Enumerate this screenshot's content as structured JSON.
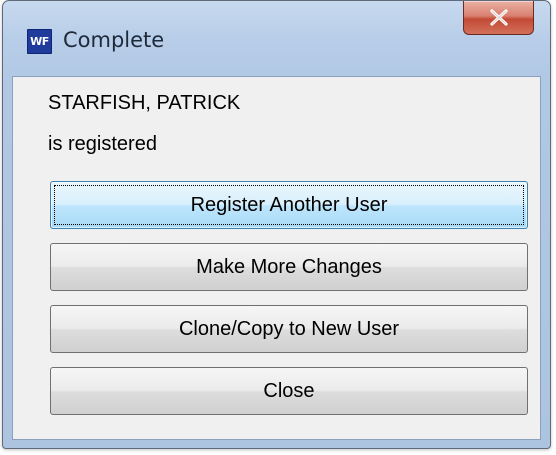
{
  "window": {
    "icon_text": "WF",
    "title": "Complete"
  },
  "message": {
    "name": "STARFISH, PATRICK",
    "status": "is registered"
  },
  "buttons": {
    "register_another": "Register Another User",
    "make_changes": "Make More Changes",
    "clone_copy": "Clone/Copy to New User",
    "close": "Close"
  },
  "colors": {
    "frame": "#b7cde8",
    "client_background": "#f0f0f0",
    "close_button": "#c24a35",
    "default_button": "#bee6fd"
  },
  "icons": {
    "app": "wf-app-icon",
    "close": "close-icon"
  }
}
